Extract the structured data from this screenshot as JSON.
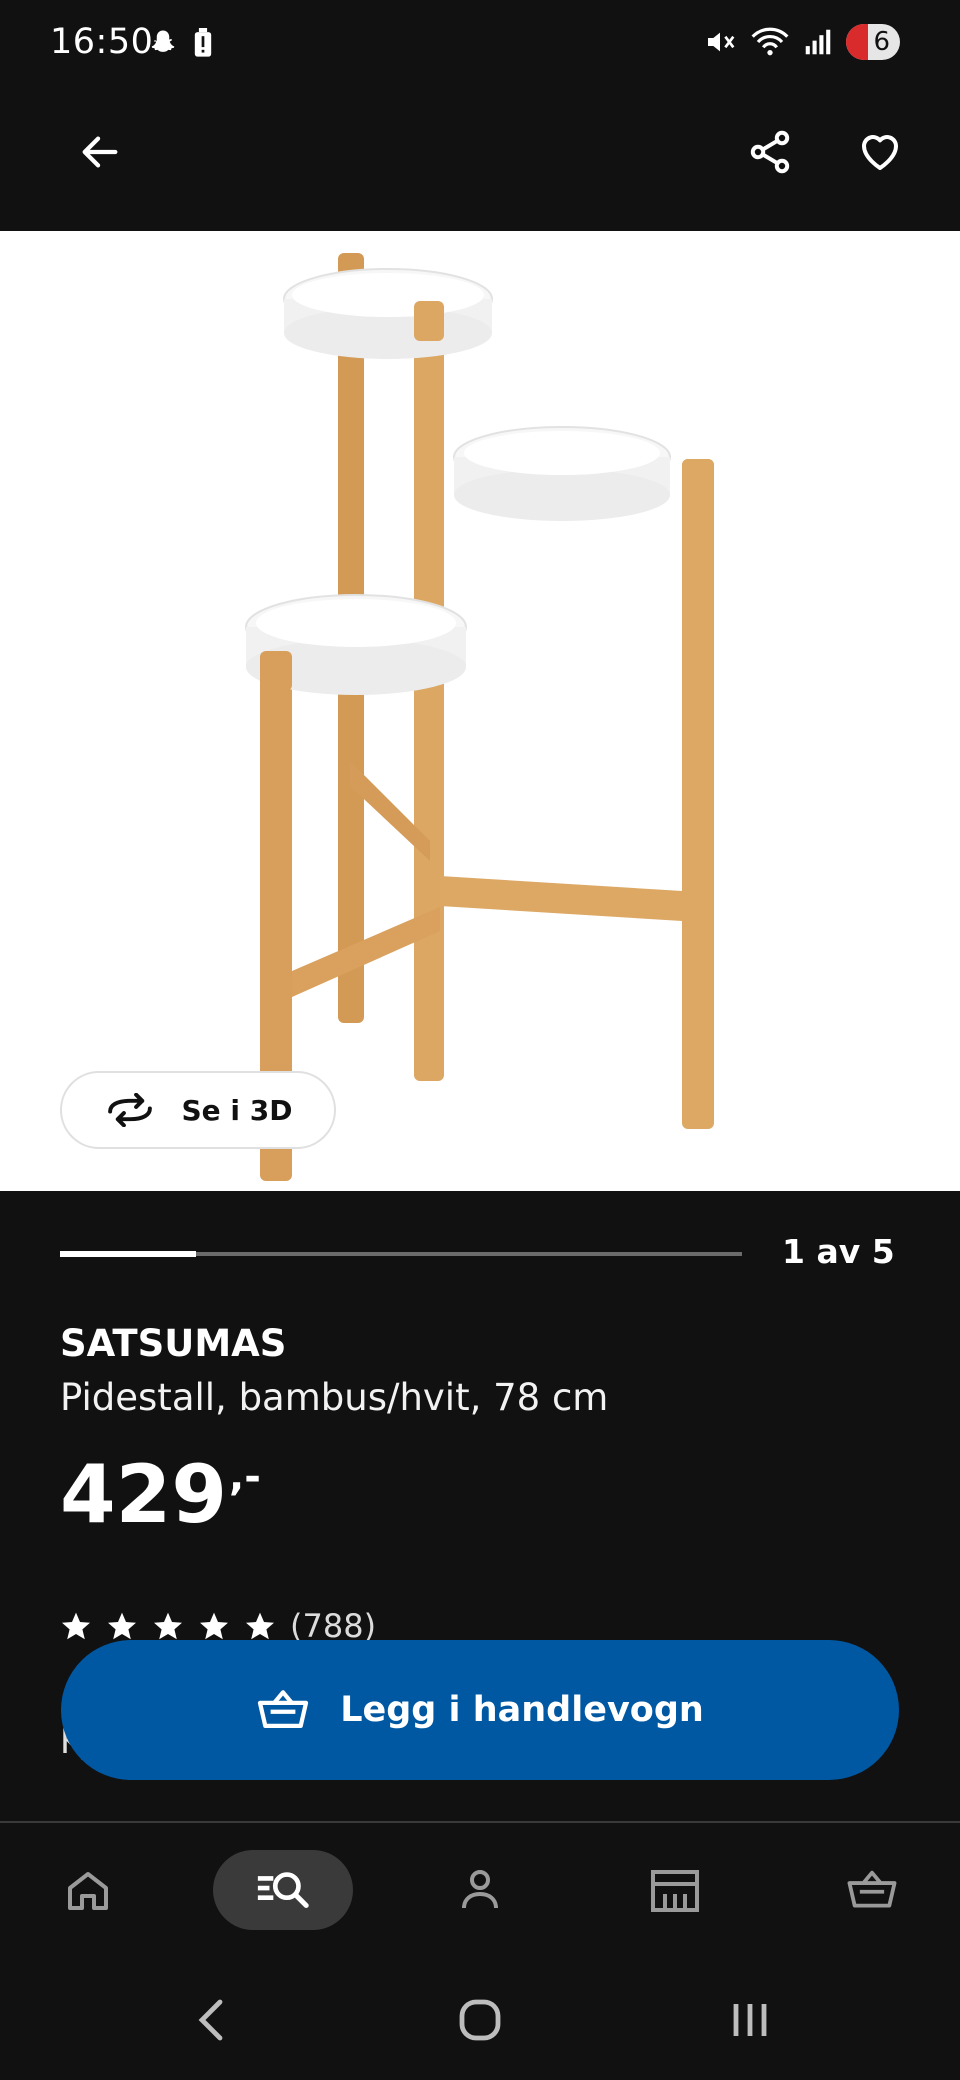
{
  "status_bar": {
    "time": "16:50",
    "battery_label": "6"
  },
  "app_bar": {
    "icons": [
      "back-arrow-icon",
      "share-icon",
      "heart-icon"
    ]
  },
  "gallery": {
    "view_3d_label": "Se i 3D",
    "counter": "1 av 5",
    "progress": 0.2
  },
  "product": {
    "name": "SATSUMAS",
    "description": "Pidestall, bambus/hvit, 78 cm",
    "price": "429",
    "price_suffix": ",-",
    "rating_stars": 5,
    "review_count": "(788)",
    "partial_line": "Kj"
  },
  "cta": {
    "add_to_cart_label": "Legg i handlevogn"
  },
  "bottom_nav": {
    "items": [
      "home-icon",
      "search-icon",
      "profile-icon",
      "store-icon",
      "cart-icon"
    ],
    "active": "search-icon"
  },
  "colors": {
    "background": "#111111",
    "accent_blue": "#0058a3",
    "bamboo": "#d9a35f",
    "white": "#ffffff"
  }
}
